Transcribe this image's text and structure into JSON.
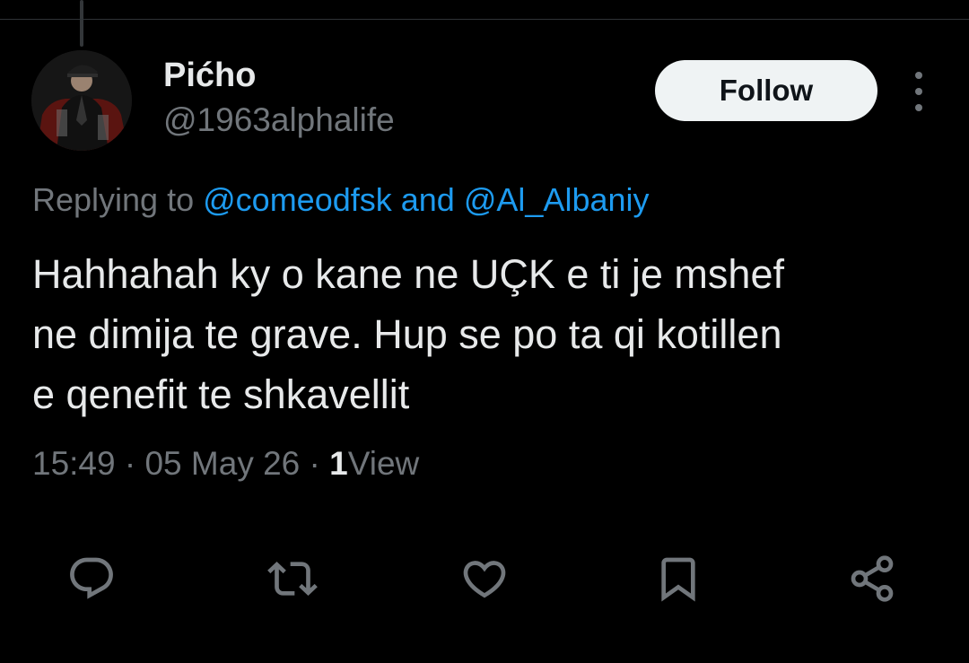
{
  "tweet": {
    "author": {
      "display_name": "Pićho",
      "handle": "@1963alphalife"
    },
    "follow_label": "Follow",
    "replying_prefix": "Replying to",
    "reply_targets": [
      "@comeodfsk",
      "@Al_Albaniy"
    ],
    "reply_conjunction": "and",
    "text": "Hahhahah ky o kane ne UÇK e ti je mshef\nne dimija te grave. Hup se po ta qi kotillen\ne qenefit te shkavellit",
    "time": "15:49",
    "date": "05 May 26",
    "separator": "·",
    "views_count": "1",
    "views_label": "View"
  },
  "actions": [
    {
      "name": "reply",
      "icon": "reply-icon"
    },
    {
      "name": "retweet",
      "icon": "retweet-icon"
    },
    {
      "name": "like",
      "icon": "heart-icon"
    },
    {
      "name": "bookmark",
      "icon": "bookmark-icon"
    },
    {
      "name": "share",
      "icon": "share-icon"
    }
  ],
  "colors": {
    "background": "#000000",
    "text": "#e7e9ea",
    "secondary": "#71767b",
    "link": "#1d9bf0",
    "button_bg": "#eff3f4"
  }
}
